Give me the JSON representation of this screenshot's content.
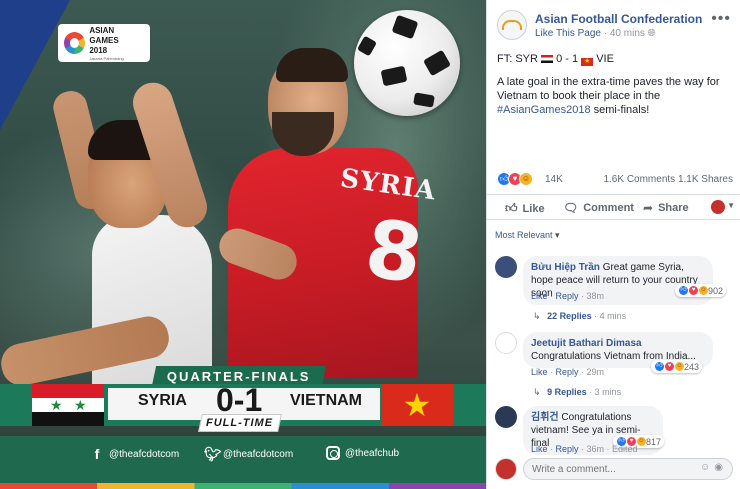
{
  "photo": {
    "badge": {
      "line1": "ASIAN GAMES",
      "line2": "2018",
      "line3": "Jakarta Palembang"
    },
    "jersey_name": "SYRIA",
    "jersey_number": "8",
    "stage_label": "QUARTER-FINALS",
    "team_left": "SYRIA",
    "score": "0-1",
    "team_right": "VIETNAM",
    "status_label": "FULL-TIME",
    "social": {
      "facebook": "@theafcdotcom",
      "twitter": "@theafcdotcom",
      "instagram": "@theafchub"
    }
  },
  "post": {
    "page_name": "Asian Football Confederation",
    "like_page": "Like This Page",
    "time": "40 mins",
    "result_prefix": "FT: SYR",
    "result_score": "0 - 1",
    "result_suffix": "VIE",
    "body_before": "A late goal in the extra-time paves the way for Vietnam to book their place in the",
    "hashtag": "#AsianGames2018",
    "body_after": "semi-finals!",
    "reaction_count": "14K",
    "comments_count": "1.6K Comments",
    "shares_count": "1.1K Shares",
    "actions": {
      "like": "Like",
      "comment": "Comment",
      "share": "Share"
    },
    "sort_label": "Most Relevant"
  },
  "comments": [
    {
      "author": "Bửu Hiệp Trần",
      "text": "Great game Syria, hope peace will return to your country soon",
      "reactions": "902",
      "like": "Like",
      "reply": "Reply",
      "time": "38m",
      "replies": "22 Replies",
      "replies_time": "4 mins"
    },
    {
      "author": "Jeetujit Bathari Dimasa",
      "text": "Congratulations Vietnam from India...",
      "reactions": "243",
      "like": "Like",
      "reply": "Reply",
      "time": "29m",
      "replies": "9 Replies",
      "replies_time": "3 mins"
    },
    {
      "author": "김휘건",
      "text": "Congratulations vietnam! See ya in semi-final",
      "reactions": "817",
      "like": "Like",
      "reply": "Reply",
      "time": "36m",
      "edited": "Edited"
    }
  ],
  "write_comment": {
    "placeholder": "Write a comment..."
  },
  "colors": {
    "facebook_link": "#365899",
    "syria_red": "#e2252e",
    "afc_green": "#1c7a5a"
  }
}
